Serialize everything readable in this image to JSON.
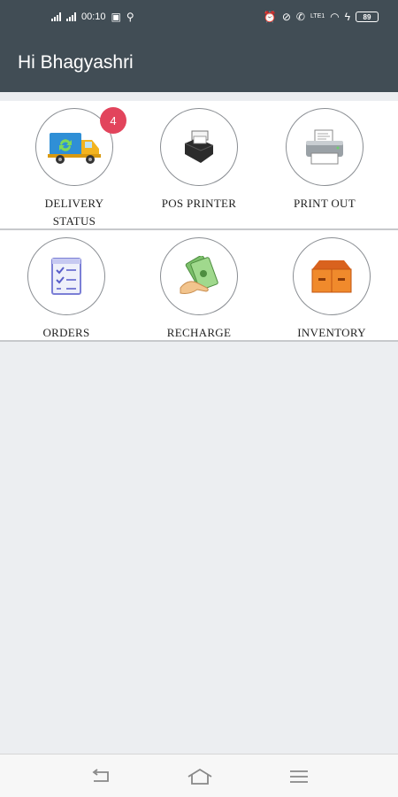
{
  "status_bar": {
    "time": "00:10",
    "battery": "89",
    "lte_label": "LTE1"
  },
  "app_bar": {
    "greeting": "Hi Bhagyashri"
  },
  "tiles": [
    {
      "label": "DELIVERY\nSTATUS",
      "icon": "delivery-truck-icon",
      "badge": "4"
    },
    {
      "label": "POS PRINTER",
      "icon": "pos-printer-icon"
    },
    {
      "label": "PRINT OUT",
      "icon": "printer-icon"
    },
    {
      "label": "ORDERS",
      "icon": "checklist-icon"
    },
    {
      "label": "RECHARGE",
      "icon": "cash-hand-icon"
    },
    {
      "label": "INVENTORY",
      "icon": "boxes-icon"
    }
  ],
  "colors": {
    "header": "#414d55",
    "badge": "#e2445c",
    "background": "#eceef1"
  },
  "nav_bar": {
    "icons": [
      "back-icon",
      "home-icon",
      "menu-icon"
    ]
  }
}
